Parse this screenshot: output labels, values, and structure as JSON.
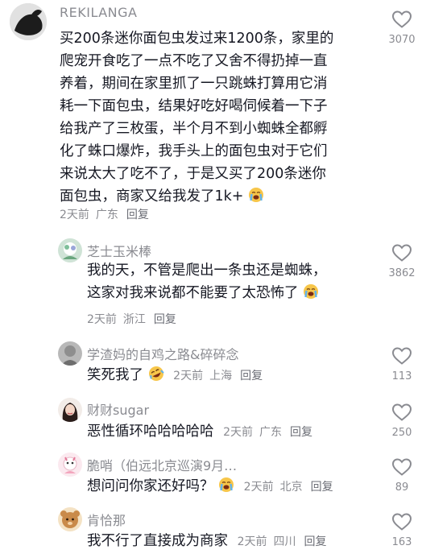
{
  "comments": [
    {
      "username": "REKILANGA",
      "lines": [
        "买200条迷你面包虫发过来1200条，家里的",
        "爬宠开食吃了一点不吃了又舍不得扔掉一直",
        "养着，期间在家里抓了一只跳蛛打算用它消",
        "耗一下面包虫，结果好吃好喝伺候着一下子",
        "给我产了三枚蛋，半个月不到小蜘蛛全都孵",
        "化了蛛口爆炸，我手头上的面包虫对于它们",
        "来说太大了吃不了，于是又买了200条迷你",
        "面包虫，商家又给我发了1k+"
      ],
      "time": "2天前",
      "location": "广东",
      "reply": "回复",
      "likes": "3070"
    },
    {
      "username": "芝士玉米棒",
      "lines": [
        "我的天，不管是爬出一条虫还是蜘蛛，",
        "这家对我来说都不能要了太恐怖了"
      ],
      "time": "2天前",
      "location": "浙江",
      "reply": "回复",
      "likes": "3862"
    },
    {
      "username": "学渣妈的自鸡之路&碎碎念",
      "text": "笑死我了",
      "time": "2天前",
      "location": "上海",
      "reply": "回复",
      "likes": "113"
    },
    {
      "username": "财财sugar",
      "text": "恶性循环哈哈哈哈哈",
      "time": "2天前",
      "location": "广东",
      "reply": "回复",
      "likes": "250"
    },
    {
      "username": "脆哨（伯远北京巡演9月…",
      "text": "想问问你家还好吗？",
      "time": "2天前",
      "location": "北京",
      "reply": "回复",
      "likes": "89"
    },
    {
      "username": "肯恰那",
      "text": "我不行了直接成为商家",
      "time": "2天前",
      "location": "四川",
      "reply": "回复",
      "likes": "163"
    }
  ],
  "icons": {
    "like": "heart-outline-icon",
    "crying": "loudly-crying-face-icon",
    "laughing": "rolling-on-floor-laughing-icon"
  },
  "colors": {
    "text": "#161823",
    "secondary": "#8a8b91",
    "reply": "#6b6d75",
    "heart_outline": "#8a8b91"
  }
}
